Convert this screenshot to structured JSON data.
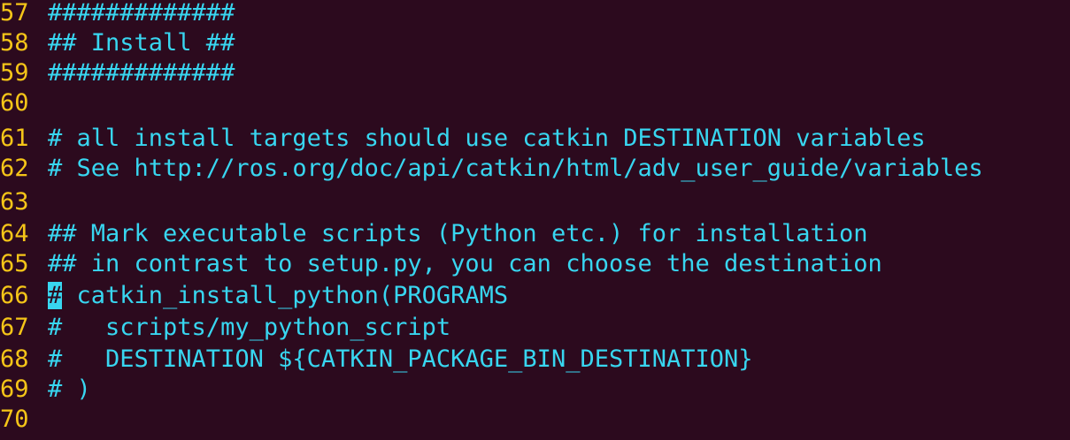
{
  "editor": {
    "lines": [
      {
        "number": "57",
        "text": "#############"
      },
      {
        "number": "58",
        "text": "## Install ##"
      },
      {
        "number": "59",
        "text": "#############"
      },
      {
        "number": "60",
        "text": ""
      },
      {
        "number": "61",
        "text": "# all install targets should use catkin DESTINATION variables"
      },
      {
        "number": "62",
        "text": "# See http://ros.org/doc/api/catkin/html/adv_user_guide/variables"
      },
      {
        "number": "63",
        "text": ""
      },
      {
        "number": "64",
        "text": "## Mark executable scripts (Python etc.) for installation"
      },
      {
        "number": "65",
        "text": "## in contrast to setup.py, you can choose the destination"
      },
      {
        "number": "66",
        "cursor_char": "#",
        "text": " catkin_install_python(PROGRAMS"
      },
      {
        "number": "67",
        "text": "#   scripts/my_python_script"
      },
      {
        "number": "68",
        "text": "#   DESTINATION ${CATKIN_PACKAGE_BIN_DESTINATION}"
      },
      {
        "number": "69",
        "text": "# )"
      },
      {
        "number": "70",
        "text": ""
      }
    ]
  },
  "colors": {
    "background": "#2c0a1e",
    "line_number": "#f5c518",
    "comment": "#38d6f0"
  }
}
